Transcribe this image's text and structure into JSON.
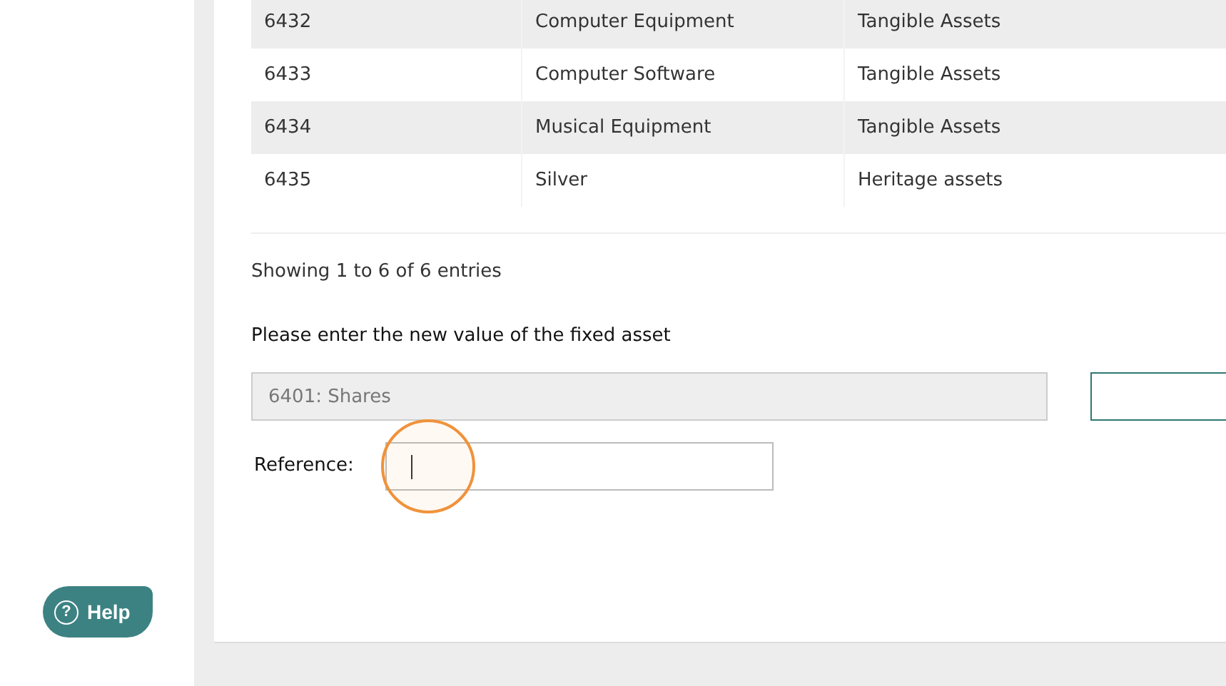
{
  "table": {
    "rows": [
      {
        "cells": [
          "6432",
          "Computer Equipment",
          "Tangible Assets"
        ]
      },
      {
        "cells": [
          "6433",
          "Computer Software",
          "Tangible Assets"
        ]
      },
      {
        "cells": [
          "6434",
          "Musical Equipment",
          "Tangible Assets"
        ]
      },
      {
        "cells": [
          "6435",
          "Silver",
          "Heritage assets"
        ]
      }
    ]
  },
  "table_info": "Showing 1 to 6 of 6 entries",
  "form": {
    "heading": "Please enter the new value of the fixed asset",
    "asset_field": {
      "value": "6401: Shares",
      "disabled": true
    },
    "reference": {
      "label": "Reference:",
      "focused": true
    }
  },
  "help_button": {
    "icon": "?",
    "label": "Help"
  }
}
